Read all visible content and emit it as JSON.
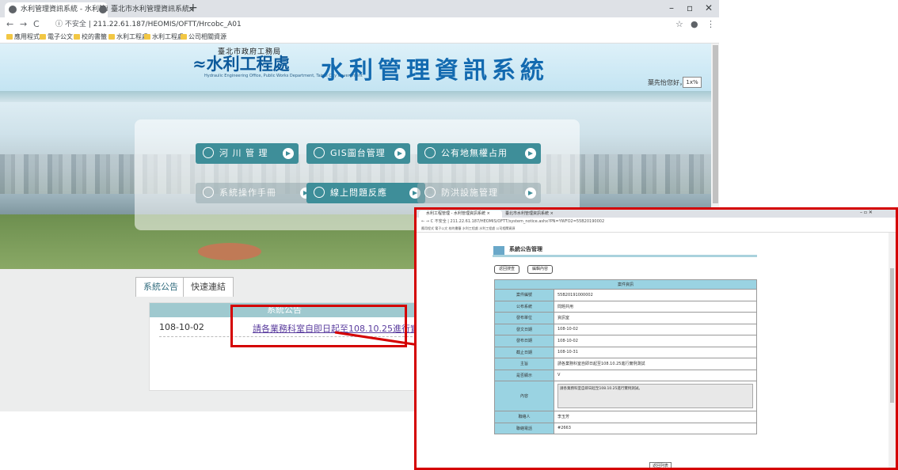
{
  "browser": {
    "tabs": [
      {
        "title": "水利管理資訊系統 - 水利管理資訊 ×"
      },
      {
        "title": "臺北市水利管理資訊系統"
      }
    ],
    "url": "211.22.61.187/HEOMIS/OFTT/Hrcobc_A01",
    "url_security": "不安全",
    "bookmarks": [
      "應用程式",
      "電子公文",
      "校的書籤",
      "水利工程處",
      "水利工程處",
      "公司相關資源"
    ]
  },
  "header": {
    "logo_sub": "臺北市政府工務局",
    "logo_main": "水利工程處",
    "logo_en": "Hydraulic Engineering Office, Public Works Department, Taipei City Government",
    "system_title": "水利管理資訊系統",
    "greeting": "葉先怡您好，",
    "font_size_btn": "1x%"
  },
  "menu": {
    "row1": [
      {
        "label": "河 川 管 理",
        "active": true
      },
      {
        "label": "GIS圖台管理",
        "active": true
      },
      {
        "label": "公有地無權占用",
        "active": true
      }
    ],
    "row2": [
      {
        "label": "系統操作手冊",
        "active": false
      },
      {
        "label": "線上問題反應",
        "active": true
      },
      {
        "label": "防洪設施管理",
        "active": false
      }
    ]
  },
  "notice_tabs": [
    "系統公告",
    "快速連結"
  ],
  "notice": {
    "header": "系統公告",
    "date": "108-10-02",
    "link": "請各業務科室自即日起至108.10.25進行實例測試"
  },
  "popup": {
    "tabs": [
      "水利工程管理 - 水利管理資訊系統 ×",
      "臺北市水利管理資訊系統 ×"
    ],
    "url": "不安全 | 211.22.61.187/HEOMIS/OFTT/system_notice.ashx?PN=YWFO2=55B20190002",
    "bookmarks": "應用程式  電子公文  校的書籤  水利工程處  水利工程處  公司相關資源",
    "title": "系統公告管理",
    "buttons": [
      "返回搜查",
      "編輯內容"
    ],
    "table_header": "案件資訊",
    "rows": [
      {
        "key": "案件編號",
        "value": "55B20191000002"
      },
      {
        "key": "公布系統",
        "value": "問題共用"
      },
      {
        "key": "發布單位",
        "value": "資訊室"
      },
      {
        "key": "發文日期",
        "value": "108-10-02"
      },
      {
        "key": "發布日期",
        "value": "108-10-02"
      },
      {
        "key": "截止日期",
        "value": "108-10-31"
      },
      {
        "key": "主旨",
        "value": "請各業務科室自即日起至108.10.25進行實例測試"
      },
      {
        "key": "是否顯示",
        "value": "V"
      },
      {
        "key": "內容",
        "value": "請各業務科室自即日起至108.10.25進行實例測試。"
      },
      {
        "key": "聯絡人",
        "value": "李玉芳"
      },
      {
        "key": "聯絡電話",
        "value": "#2663"
      }
    ],
    "back_button": "返回列表"
  }
}
